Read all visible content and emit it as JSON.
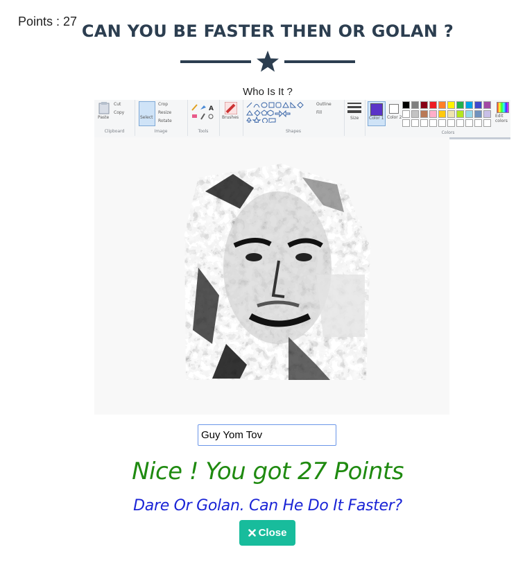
{
  "header": {
    "points_label": "Points : 27",
    "title": "CAN YOU BE FASTER THEN OR GOLAN ?",
    "divider_icon": "star-icon"
  },
  "question": "Who Is It ?",
  "paint_toolbar": {
    "clipboard": {
      "paste": "Paste",
      "cut": "Cut",
      "copy": "Copy",
      "label": "Clipboard"
    },
    "image": {
      "select": "Select",
      "crop": "Crop",
      "resize": "Resize",
      "rotate": "Rotate",
      "label": "Image"
    },
    "tools": {
      "label": "Tools"
    },
    "brushes": {
      "label": "Brushes"
    },
    "shapes": {
      "outline": "Outline",
      "fill": "Fill",
      "label": "Shapes"
    },
    "size": {
      "label": "Size"
    },
    "color1": {
      "label": "Color 1",
      "value": "#5a33c8"
    },
    "color2": {
      "label": "Color 2"
    },
    "edit_colors": {
      "label": "Edit colors"
    },
    "colors_label": "Colors",
    "palette_row1": [
      "#000000",
      "#7f7f7f",
      "#880015",
      "#ed1c24",
      "#ff7f27",
      "#fff200",
      "#22b14c",
      "#00a2e8",
      "#3f48cc",
      "#a349a4"
    ],
    "palette_row2": [
      "#ffffff",
      "#c3c3c3",
      "#b97a57",
      "#ffaec9",
      "#ffc90e",
      "#efe4b0",
      "#b5e61d",
      "#99d9ea",
      "#7092be",
      "#c8bfe7"
    ]
  },
  "answer_input": {
    "value": "Guy Yom Tov"
  },
  "result": {
    "message": "Nice ! You got 27 Points",
    "challenge": "Dare Or Golan. Can He Do It Faster?"
  },
  "close_button": {
    "label": "Close",
    "icon": "close-icon"
  },
  "colors": {
    "title": "#2c3e50",
    "success": "#1f8a10",
    "challenge": "#1a24d6",
    "button": "#18bc9c"
  }
}
